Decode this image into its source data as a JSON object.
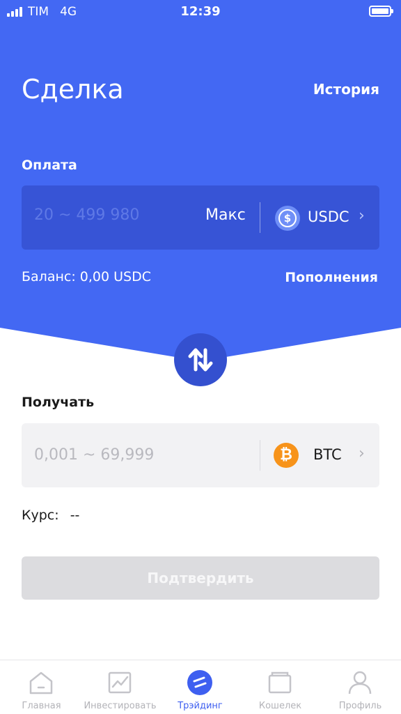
{
  "status_bar": {
    "carrier": "TIM",
    "network": "4G",
    "time": "12:39"
  },
  "header": {
    "title": "Сделка",
    "history_link": "История"
  },
  "payment": {
    "label": "Оплата",
    "amount_placeholder": "20 ~ 499 980",
    "max_label": "Макс",
    "currency": "USDC",
    "currency_icon": "usdc-coin-icon",
    "balance_text": "Баланс: 0,00 USDC",
    "deposit_link": "Пополнения"
  },
  "swap": {
    "icon": "swap-arrows-icon"
  },
  "receive": {
    "label": "Получать",
    "amount_placeholder": "0,001 ~ 69,999",
    "currency": "BTC",
    "currency_icon": "bitcoin-coin-icon",
    "currency_symbol": "₿"
  },
  "rate": {
    "label": "Курс:",
    "value": "--"
  },
  "confirm_button": {
    "label": "Подтвердить",
    "enabled": false
  },
  "tabbar": {
    "active": "Трэйдинг",
    "items": [
      {
        "label": "Главная",
        "icon": "home-icon"
      },
      {
        "label": "Инвестировать",
        "icon": "chart-icon"
      },
      {
        "label": "Трэйдинг",
        "icon": "trading-icon"
      },
      {
        "label": "Кошелек",
        "icon": "wallet-icon"
      },
      {
        "label": "Профиль",
        "icon": "profile-icon"
      }
    ]
  },
  "colors": {
    "primary": "#4368f3",
    "panel": "#3754d6",
    "swap_button": "#3450cf",
    "btc": "#f7931a",
    "disabled_button": "#dcdcdf"
  }
}
